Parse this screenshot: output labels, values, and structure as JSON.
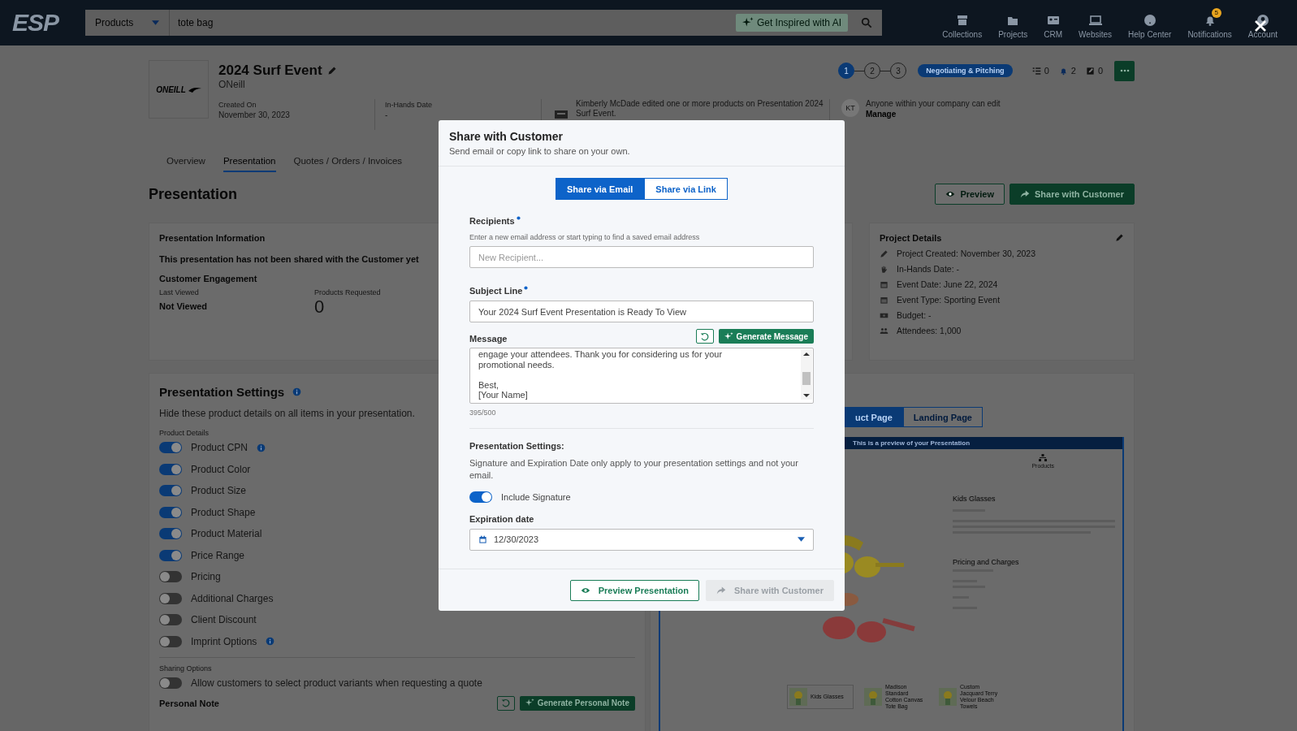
{
  "nav": {
    "logo": "ESP",
    "search_category": "Products",
    "search_value": "tote bag",
    "ai_button": "Get Inspired with AI",
    "items": [
      {
        "kind": "collections",
        "label": "Collections"
      },
      {
        "kind": "projects",
        "label": "Projects"
      },
      {
        "kind": "crm",
        "label": "CRM"
      },
      {
        "kind": "websites",
        "label": "Websites"
      },
      {
        "kind": "help",
        "label": "Help Center"
      },
      {
        "kind": "notifications",
        "label": "Notifications",
        "badge": "5"
      },
      {
        "kind": "account",
        "label": "Account"
      }
    ]
  },
  "project": {
    "logo_text": "ONEILL",
    "title": "2024 Surf Event",
    "company": "ONeill",
    "created_label": "Created On",
    "created_value": "November 30, 2023",
    "inhands_label": "In-Hands Date",
    "inhands_value": "-",
    "activity": "Kimberly McDade edited one or more products on Presentation 2024 Surf Event.",
    "avatar": "KT",
    "access": "Anyone within your company can edit",
    "access_link": "Manage",
    "steps": [
      {
        "label": "1",
        "selected": true
      },
      {
        "label": "2",
        "selected": false
      },
      {
        "label": "3",
        "selected": false
      }
    ],
    "status": "Negotiating & Pitching",
    "counts": [
      {
        "kind": "tasks",
        "value": "0"
      },
      {
        "kind": "alerts",
        "value": "2"
      },
      {
        "kind": "notes",
        "value": "0"
      }
    ]
  },
  "tabs": [
    {
      "label": "Overview",
      "selected": false
    },
    {
      "label": "Presentation",
      "selected": true
    },
    {
      "label": "Quotes / Orders / Invoices",
      "selected": false
    }
  ],
  "page_title": "Presentation",
  "actions": [
    {
      "kind": "outline",
      "label": "Preview"
    },
    {
      "kind": "filled",
      "label": "Share with Customer"
    }
  ],
  "info_card": {
    "title": "Presentation Information",
    "notice": "This presentation has not been shared with the Customer yet",
    "engagement": "Customer Engagement",
    "last_viewed_label": "Last Viewed",
    "last_viewed_value": "Not Viewed",
    "requested_label": "Products Requested",
    "requested_value": "0"
  },
  "project_details": {
    "title": "Project Details",
    "rows": [
      {
        "kind": "pencil",
        "text": "Project Created: November 30, 2023"
      },
      {
        "kind": "hand",
        "text": "In-Hands Date: -"
      },
      {
        "kind": "calendar",
        "text": "Event Date: June 22, 2024"
      },
      {
        "kind": "calendar",
        "text": "Event Type: Sporting Event"
      },
      {
        "kind": "money",
        "text": "Budget: -"
      },
      {
        "kind": "people",
        "text": "Attendees: 1,000"
      }
    ]
  },
  "settings": {
    "title": "Presentation Settings",
    "description": "Hide these product details on all items in your presentation.",
    "group_label": "Product Details",
    "items": [
      {
        "label": "Product CPN",
        "on": true,
        "info": true
      },
      {
        "label": "Product Color",
        "on": true,
        "info": false
      },
      {
        "label": "Product Size",
        "on": true,
        "info": false
      },
      {
        "label": "Product Shape",
        "on": true,
        "info": false
      },
      {
        "label": "Product Material",
        "on": true,
        "info": false
      },
      {
        "label": "Price Range",
        "on": true,
        "info": false
      },
      {
        "label": "Pricing",
        "on": false,
        "info": false
      },
      {
        "label": "Additional Charges",
        "on": false,
        "info": false
      },
      {
        "label": "Client Discount",
        "on": false,
        "info": false
      },
      {
        "label": "Imprint Options",
        "on": false,
        "info": true
      }
    ],
    "sharing_label": "Sharing Options",
    "sharing_items": [
      {
        "label": "Allow customers to select product variants when requesting a quote",
        "on": false
      }
    ],
    "note_label": "Personal Note",
    "note_button": "Generate Personal Note"
  },
  "preview": {
    "tabs": [
      {
        "label": "uct Page",
        "selected": true
      },
      {
        "label": "Landing Page",
        "selected": false
      }
    ],
    "banner": "This is a preview of your Presentation",
    "nav_label": "Products",
    "product_title": "Kids Glasses",
    "section_title": "Pricing and Charges",
    "thumbnails": [
      {
        "title": "Kids Glasses",
        "selected": true
      },
      {
        "title": "Madison Standard Cotton Canvas Tote Bag",
        "selected": false
      },
      {
        "title": "Custom Jacquard Terry Velour Beach Towels",
        "selected": false
      }
    ]
  },
  "modal": {
    "title": "Share with Customer",
    "subtitle": "Send email or copy link to share on your own.",
    "modes": [
      {
        "label": "Share via Email",
        "selected": true
      },
      {
        "label": "Share via Link",
        "selected": false
      }
    ],
    "recipients_label": "Recipients",
    "recipients_hint": "Enter a new email address or start typing to find a saved email address",
    "recipients_placeholder": "New Recipient...",
    "subject_label": "Subject Line",
    "subject_value": "Your 2024 Surf Event Presentation is Ready To View",
    "message_label": "Message",
    "generate_button": "Generate Message",
    "message_value": "engage your attendees. Thank you for considering us for your\npromotional needs.\n\nBest,\n[Your Name]",
    "counter": "395/500",
    "settings_title": "Presentation Settings:",
    "settings_text": "Signature and Expiration Date only apply to your presentation settings and not your email.",
    "signature_label": "Include Signature",
    "signature_on": true,
    "expiration_label": "Expiration date",
    "expiration_value": "12/30/2023",
    "buttons": [
      {
        "kind": "outline",
        "label": "Preview Presentation",
        "disabled": false
      },
      {
        "kind": "filled",
        "label": "Share with Customer",
        "disabled": true
      }
    ]
  }
}
